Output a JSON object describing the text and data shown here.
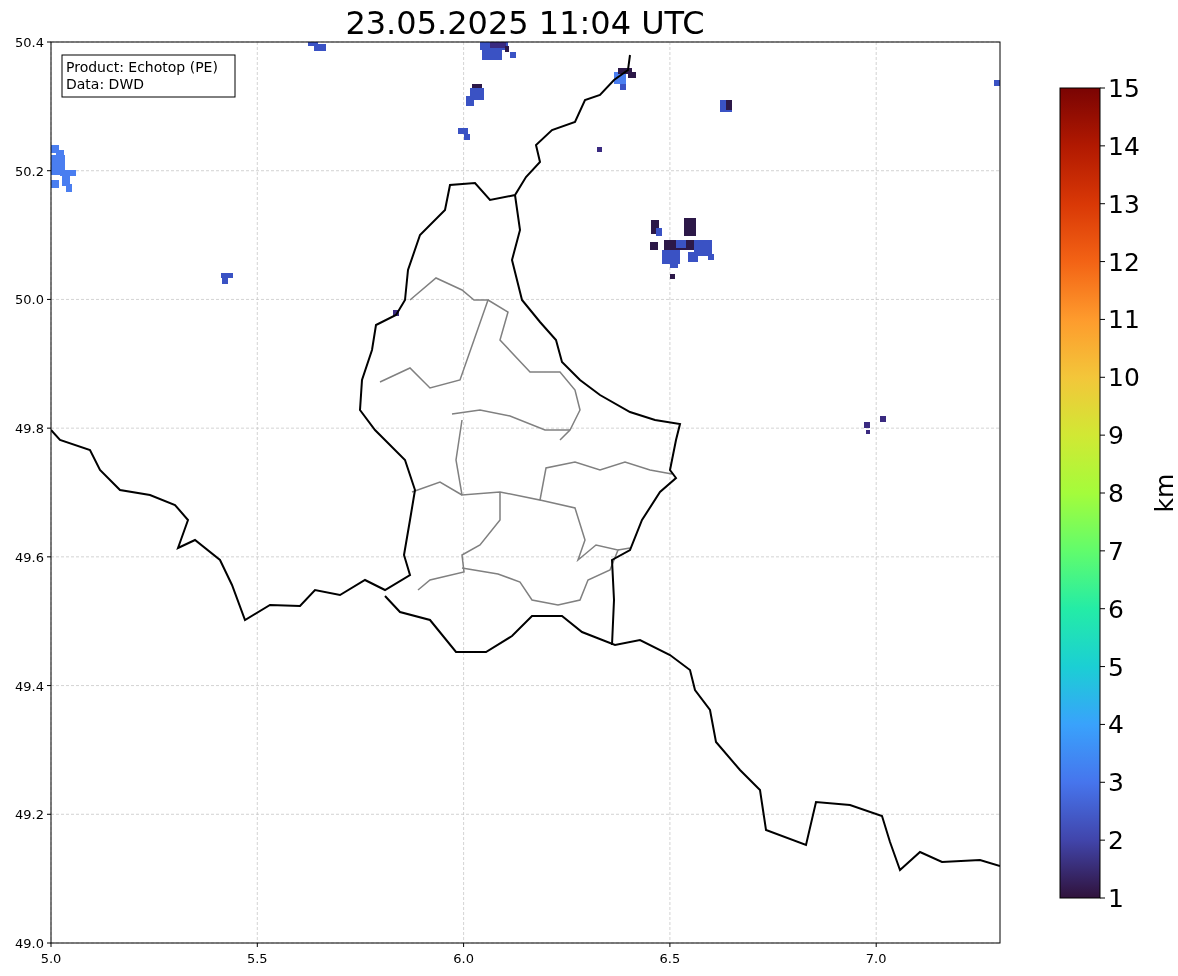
{
  "title": "23.05.2025 11:04 UTC",
  "info_box": {
    "lines": [
      "Product: Echotop (PE)",
      "Data: DWD"
    ]
  },
  "x_axis": {
    "ticks": [
      "5.0",
      "5.5",
      "6.0",
      "6.5",
      "7.0"
    ]
  },
  "y_axis": {
    "ticks": [
      "50.4",
      "50.2",
      "50.0",
      "49.8",
      "49.6",
      "49.4",
      "49.2",
      "49.0"
    ]
  },
  "colorbar": {
    "label": "km",
    "ticks": [
      "15",
      "14",
      "13",
      "12",
      "11",
      "10",
      "9",
      "8",
      "7",
      "6",
      "5",
      "4",
      "3",
      "2",
      "1"
    ]
  }
}
